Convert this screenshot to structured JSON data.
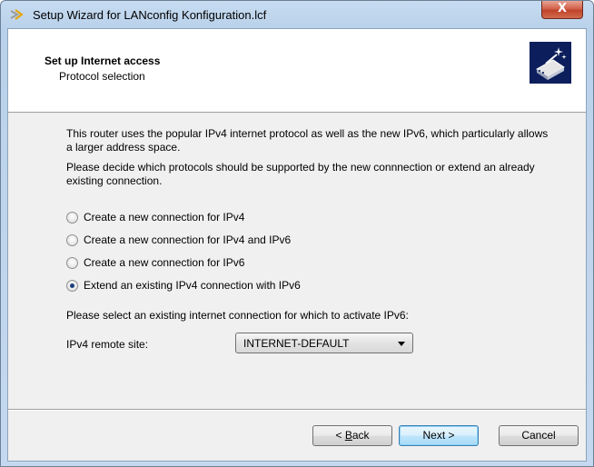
{
  "window": {
    "title": "Setup Wizard for LANconfig Konfiguration.lcf",
    "close_glyph": "X"
  },
  "header": {
    "title": "Set up Internet access",
    "subtitle": "Protocol selection"
  },
  "content": {
    "intro": "This router uses the popular IPv4 internet protocol as well as the new IPv6, which particularly allows a larger address space.",
    "instruction": "Please decide which protocols should be supported by the new connnection or extend an already existing connection.",
    "options": [
      {
        "label": "Create a new connection for IPv4",
        "checked": false
      },
      {
        "label": "Create a new connection for IPv4 and IPv6",
        "checked": false
      },
      {
        "label": "Create a new connection for IPv6",
        "checked": false
      },
      {
        "label": "Extend an existing IPv4 connection with IPv6",
        "checked": true
      }
    ],
    "select_prompt": "Please select an existing internet connection for which to activate IPv6:",
    "remote_site_label": "IPv4 remote site:",
    "remote_site_value": "INTERNET-DEFAULT"
  },
  "buttons": {
    "back_prefix": "< ",
    "back_mnemonic": "B",
    "back_rest": "ack",
    "next_label": "Next >",
    "cancel_label": "Cancel"
  },
  "icons": {
    "title_icon": "wizard-wand-icon",
    "header_graphic": "router-wizard-icon",
    "dropdown": "chevron-down-icon"
  }
}
